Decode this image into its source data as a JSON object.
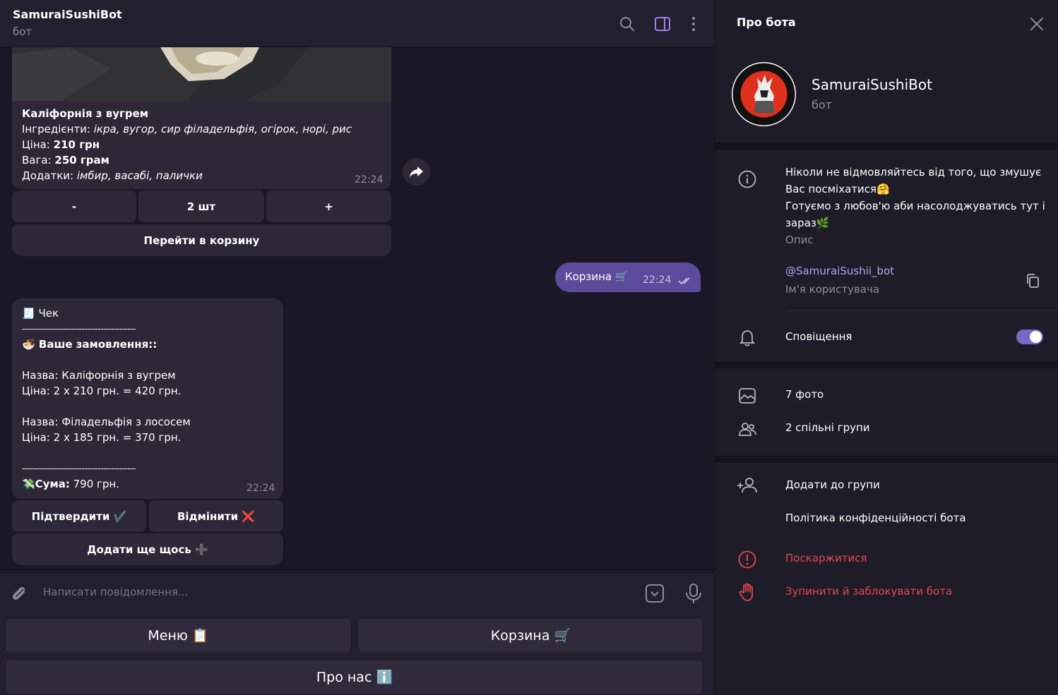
{
  "chat": {
    "title": "SamuraiSushiBot",
    "subtitle": "бот"
  },
  "product": {
    "name": "Каліфорнія з вугрем",
    "ingredients_label": "Інгредієнти:",
    "ingredients": "ікра, вугор, сир філадельфія, огірок, норі, рис",
    "price_label": "Ціна:",
    "price": "210 грн",
    "weight_label": "Вага:",
    "weight": "250 грам",
    "extras_label": "Додатки:",
    "extras": "імбир, васабі, палички",
    "time": "22:24",
    "buttons": {
      "minus": "-",
      "quantity": "2 шт",
      "plus": "+",
      "go_to_cart": "Перейти в корзину"
    }
  },
  "outgoing": {
    "text": "Корзина 🛒",
    "time": "22:24"
  },
  "receipt": {
    "title": "🧾 Чек",
    "divider": "------------------------------------------",
    "order_heading": "🍜 Ваше замовлення::",
    "item1_name": "Назва: Каліфорнія з вугрем",
    "item1_price": "Ціна: 2 x 210 грн. = 420 грн.",
    "item2_name": "Назва: Філадельфія з лососем",
    "item2_price": "Ціна: 2 x 185 грн. = 370 грн.",
    "sum_label": "💸Сума:",
    "sum_value": " 790 грн.",
    "time": "22:24",
    "buttons": {
      "confirm": "Підтвердити ✔️",
      "cancel": "Відмінити ❌",
      "add_more": "Додати ще щось ➕"
    }
  },
  "composer": {
    "placeholder": "Написати повідомлення..."
  },
  "keyboard": {
    "menu": "Меню 📋",
    "cart": "Корзина 🛒",
    "about": "Про нас ℹ️"
  },
  "panel": {
    "title": "Про бота",
    "name": "SamuraiSushiBot",
    "subtitle": "бот",
    "description_line1": "Ніколи не відмовляйтесь від того, що змушує Вас посміхатися🤗",
    "description_line2": "Готуємо з любов'ю аби насолоджуватись тут і зараз🌿",
    "description_caption": "Опис",
    "username": "@SamuraiSushii_bot",
    "username_caption": "Ім'я користувача",
    "notifications": "Сповіщення",
    "notifications_on": true,
    "photos": "7 фото",
    "groups": "2 спільні групи",
    "add_to_group": "Додати до групи",
    "privacy": "Політика конфіденційності бота",
    "report": "Поскаржитися",
    "block": "Зупинити й заблокувати бота"
  },
  "colors": {
    "accent": "#7a67c8",
    "link": "#b3a2f0",
    "danger": "#e5474c",
    "outgoing_bubble": "#5c4b9a"
  }
}
